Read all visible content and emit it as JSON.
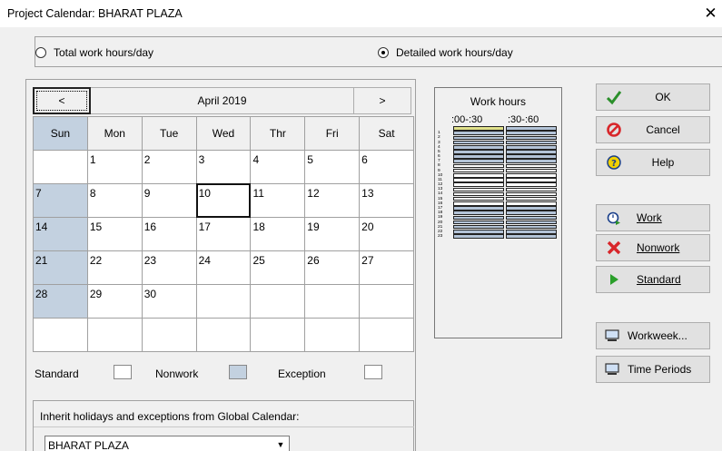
{
  "window": {
    "title": "Project Calendar: BHARAT PLAZA",
    "close_glyph": "✕"
  },
  "mode": {
    "option_total": "Total work hours/day",
    "option_detailed": "Detailed work hours/day",
    "selected": "detailed"
  },
  "calendar": {
    "prev_label": "<",
    "next_label": ">",
    "month": "April 2019",
    "weekdays": [
      "Sun",
      "Mon",
      "Tue",
      "Wed",
      "Thr",
      "Fri",
      "Sat"
    ],
    "weeks": [
      [
        "",
        "1",
        "2",
        "3",
        "4",
        "5",
        "6"
      ],
      [
        "7",
        "8",
        "9",
        "10",
        "11",
        "12",
        "13"
      ],
      [
        "14",
        "15",
        "16",
        "17",
        "18",
        "19",
        "20"
      ],
      [
        "21",
        "22",
        "23",
        "24",
        "25",
        "26",
        "27"
      ],
      [
        "28",
        "29",
        "30",
        "",
        "",
        "",
        ""
      ],
      [
        "",
        "",
        "",
        "",
        "",
        "",
        ""
      ]
    ],
    "selected_date": "10"
  },
  "legend": {
    "standard": "Standard",
    "nonwork": "Nonwork",
    "exception": "Exception",
    "nonwork_color": "#c3d1e0"
  },
  "inherit": {
    "label": "Inherit holidays and exceptions from Global Calendar:",
    "value": "BHARAT PLAZA"
  },
  "work_hours": {
    "title": "Work hours",
    "col1": ":00-:30",
    "col2": ":30-:60",
    "hours": [
      "",
      "1",
      "2",
      "3",
      "4",
      "5",
      "6",
      "7",
      "8",
      "9",
      "10",
      "11",
      "12",
      "13",
      "14",
      "15",
      "16",
      "17",
      "18",
      "19",
      "20",
      "21",
      "22",
      "23"
    ],
    "work_hours": [
      "8",
      "9",
      "10",
      "11",
      "12",
      "13",
      "14",
      "15",
      "16"
    ],
    "selected_cell": "first-slot-hour-0"
  },
  "buttons": {
    "ok": "OK",
    "cancel": "Cancel",
    "help": "Help",
    "work": "Work",
    "nonwork": "Nonwork",
    "standard": "Standard",
    "workweek": "Workweek...",
    "time_periods": "Time Periods"
  },
  "colors": {
    "nonwork": "#b3c3d7",
    "selected_slot": "#dfe08a",
    "ok_check": "#2a8f2a",
    "cancel_red": "#d8262a"
  }
}
